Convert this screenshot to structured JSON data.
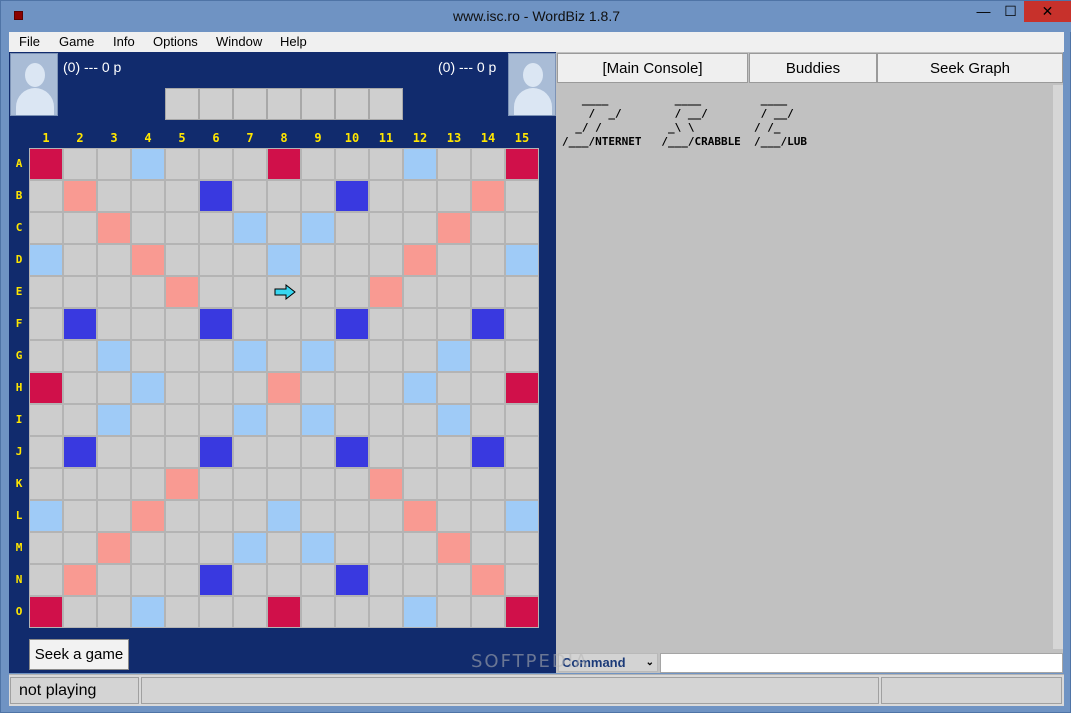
{
  "window": {
    "title": "www.isc.ro - WordBiz 1.8.7",
    "min_glyph": "—",
    "max_glyph": "☐",
    "close_glyph": "✕"
  },
  "menu": [
    "File",
    "Game",
    "Info",
    "Options",
    "Window",
    "Help"
  ],
  "players": {
    "left": {
      "score_text": "(0) ---   0 p"
    },
    "right": {
      "score_text": "(0) ---   0 p"
    }
  },
  "board": {
    "columns": [
      "1",
      "2",
      "3",
      "4",
      "5",
      "6",
      "7",
      "8",
      "9",
      "10",
      "11",
      "12",
      "13",
      "14",
      "15"
    ],
    "rows": [
      "A",
      "B",
      "C",
      "D",
      "E",
      "F",
      "G",
      "H",
      "I",
      "J",
      "K",
      "L",
      "M",
      "N",
      "O"
    ],
    "premium_rows": [
      "T..d...T...d..T",
      ".D...t...t...D.",
      "..D...d.d...D..",
      "d..D...d...D..d",
      "....D.....D....",
      ".t...t...t...t.",
      "..d...d.d...d..",
      "T..d...D...d..T",
      "..d...d.d...d..",
      ".t...t...t...t.",
      "....D.....D....",
      "d..D...d...D..d",
      "..D...d.d...D..",
      ".D...t...t...D.",
      "T..d...T...d..T"
    ],
    "colors": {
      "triple_word": "#d0104a",
      "double_word": "#f99a92",
      "triple_letter": "#3939e0",
      "double_letter": "#9fcbf7",
      "plain": "#cdcdcd"
    }
  },
  "seek_button": "Seek a game",
  "tabs": [
    "[Main Console]",
    "Buddies",
    "Seek Graph"
  ],
  "console_text": "   ____          ____         ____\n    /  _/        / __/        / __/\n  _/ /          _\\ \\         / /_\n/___/NTERNET   /___/CRABBLE  /___/LUB",
  "command": {
    "selected": "Command"
  },
  "status": {
    "main": "not playing",
    "field2": "",
    "field3": ""
  },
  "watermark": "SOFTPEDIA"
}
